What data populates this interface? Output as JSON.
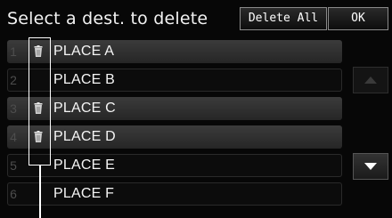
{
  "header": {
    "title": "Select a dest. to delete",
    "delete_all_label": "Delete All",
    "ok_label": "OK"
  },
  "list": {
    "items": [
      {
        "number": "1",
        "label": "PLACE A",
        "marked": true
      },
      {
        "number": "2",
        "label": "PLACE B",
        "marked": false
      },
      {
        "number": "3",
        "label": "PLACE C",
        "marked": true
      },
      {
        "number": "4",
        "label": "PLACE D",
        "marked": true
      },
      {
        "number": "5",
        "label": "PLACE E",
        "marked": false
      },
      {
        "number": "6",
        "label": "PLACE F",
        "marked": false
      }
    ]
  },
  "icons": {
    "delete_mark": "trash-icon",
    "scroll_up": "triangle-up-icon",
    "scroll_down": "triangle-down-icon"
  },
  "colors": {
    "background": "#070707",
    "row_highlight": "#3b3b3b",
    "text": "#f5f5f5",
    "disabled_arrow": "#3a3a3a"
  }
}
